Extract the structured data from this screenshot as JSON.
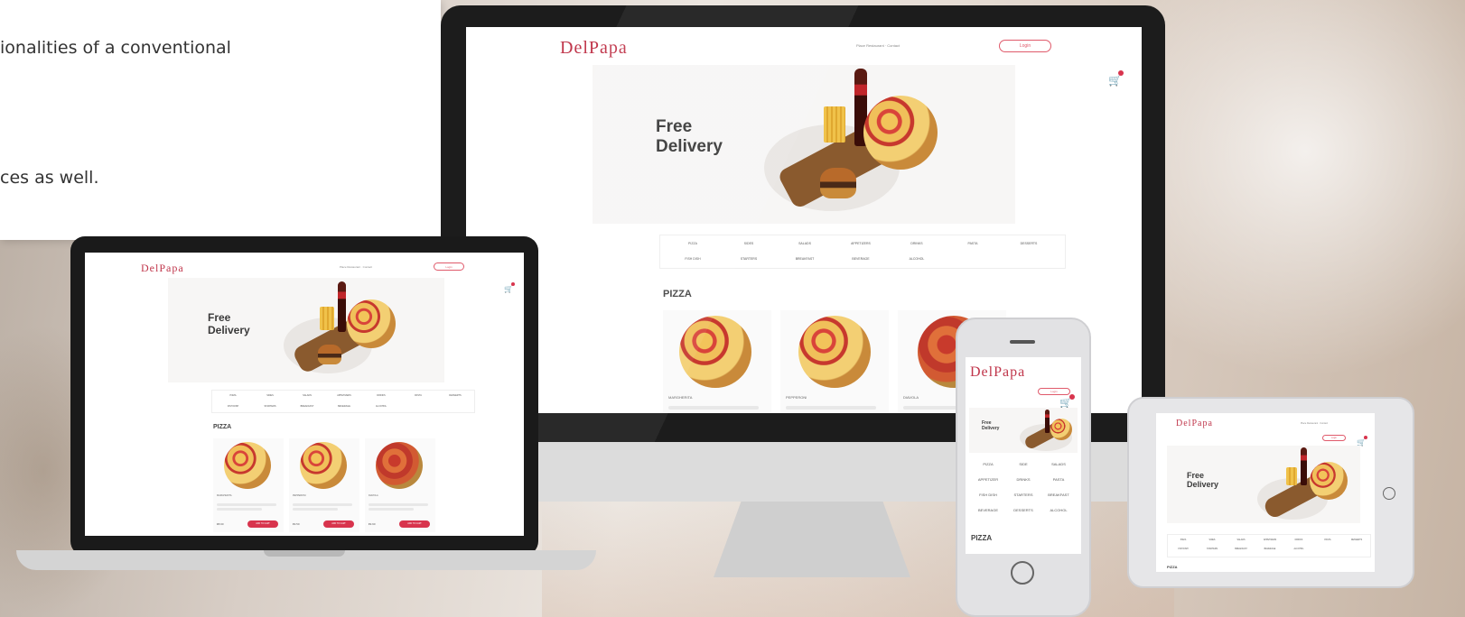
{
  "intro": {
    "line1": "ionalities of a conventional",
    "line2": "ces as well."
  },
  "site": {
    "logo": "DelPapa",
    "nav_text": "Place Restaurant · Contact",
    "login_label": "Login",
    "cart_icon": "cart-icon",
    "hero_title_1": "Free",
    "hero_title_2": "Delivery",
    "categories_row1": [
      "PIZZA",
      "SIDES",
      "SALADS",
      "APPETIZERS",
      "DRINKS",
      "PASTA",
      "DESSERTS"
    ],
    "categories_row2": [
      "FISH DISH",
      "STARTERS",
      "BREAKFAST",
      "BEVERAGE",
      "ALCOHOL"
    ],
    "phone_categories": [
      [
        "PIZZA",
        "SIDE",
        "SALADS"
      ],
      [
        "APPETIZER",
        "DRINKS",
        "PASTA"
      ],
      [
        "FISH DISH",
        "STARTERS",
        "BREAKFAST"
      ],
      [
        "BEVERAGE",
        "DESSERTS",
        "ALCOHOL"
      ]
    ],
    "section_title": "PIZZA",
    "products": [
      {
        "name": "MARGHERITA",
        "price": "€8.90",
        "button": "ADD TO CART"
      },
      {
        "name": "PEPPERONI",
        "price": "€9.50",
        "button": "ADD TO CART"
      },
      {
        "name": "DIAVOLA",
        "price": "€9.90",
        "button": "ADD TO CART"
      }
    ]
  },
  "colors": {
    "brand": "#c0364b",
    "accent": "#d8344d",
    "bezel": "#1c1c1c",
    "device_frame": "#dcdcdc"
  }
}
